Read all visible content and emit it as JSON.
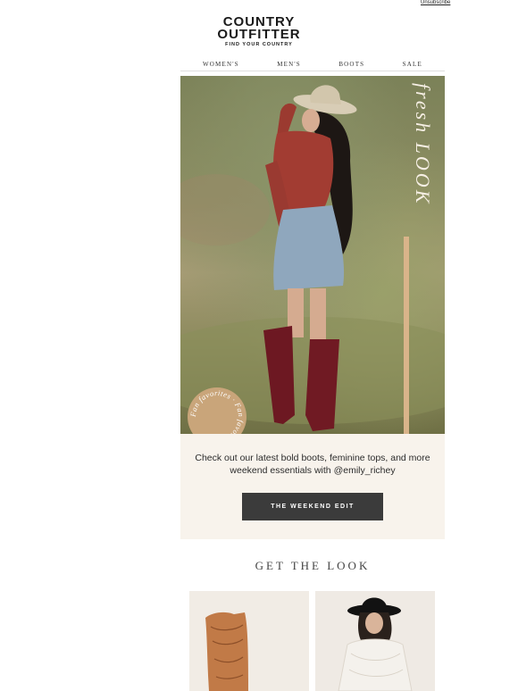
{
  "header": {
    "unsubscribe": "Unsubscribe",
    "logo_line1": "COUNTRY",
    "logo_line2": "OUTFITTER",
    "logo_tagline": "FIND YOUR COUNTRY"
  },
  "nav": {
    "items": [
      {
        "label": "WOMEN'S"
      },
      {
        "label": "MEN'S"
      },
      {
        "label": "BOOTS"
      },
      {
        "label": "SALE"
      }
    ]
  },
  "hero": {
    "overlay_text": "fresh LOOK",
    "badge_text": "Fan favorites · Fan favorites ·"
  },
  "promo": {
    "text": "Check out our latest bold boots, feminine tops, and more weekend essentials with @emily_richey",
    "button_label": "THE WEEKEND EDIT"
  },
  "section": {
    "title": "GET THE LOOK"
  },
  "colors": {
    "button_bg": "#3b3b3b",
    "promo_bg": "#f8f3ec",
    "badge_bg": "#c9a57a",
    "stripe": "#d9b48a"
  }
}
